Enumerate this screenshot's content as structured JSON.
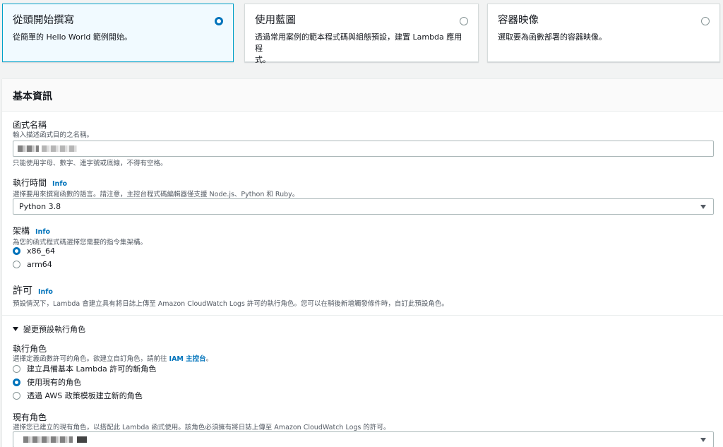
{
  "cards": [
    {
      "title": "從頭開始撰寫",
      "desc": "從簡單的 Hello World 範例開始。",
      "selected": true
    },
    {
      "title": "使用藍圖",
      "desc": "透過常用案例的範本程式碼與組態預設，建置 Lambda 應用程\n式。",
      "selected": false
    },
    {
      "title": "容器映像",
      "desc": "選取要為函數部署的容器映像。",
      "selected": false
    }
  ],
  "panel": {
    "title": "基本資訊"
  },
  "function_name": {
    "label": "函式名稱",
    "desc": "輸入描述函式目的之名稱。",
    "constraint": "只能使用字母、數字、連字號或底線，不得有空格。"
  },
  "runtime": {
    "label": "執行時間",
    "info": "Info",
    "desc": "選擇要用來撰寫函數的語言。請注意，主控台程式碼編輯器僅支援 Node.js、Python 和 Ruby。",
    "value": "Python 3.8"
  },
  "architecture": {
    "label": "架構",
    "info": "Info",
    "desc": "為您的函式程式碼選擇您需要的指令集架構。",
    "options": [
      {
        "label": "x86_64",
        "selected": true
      },
      {
        "label": "arm64",
        "selected": false
      }
    ]
  },
  "permissions": {
    "title": "許可",
    "info": "Info",
    "desc": "預設情況下，Lambda 會建立具有將日誌上傳至 Amazon CloudWatch Logs 許可的執行角色。您可以在稍後新增觸發條件時，自訂此預設角色。"
  },
  "change_role": {
    "label": "變更預設執行角色"
  },
  "execution_role": {
    "label": "執行角色",
    "desc_prefix": "選擇定義函數許可的角色。欲建立自訂角色，請前往 ",
    "desc_link": "IAM 主控台",
    "desc_suffix": "。",
    "options": [
      {
        "label": "建立具備基本 Lambda 許可的新角色",
        "selected": false
      },
      {
        "label": "使用現有的角色",
        "selected": true
      },
      {
        "label": "透過 AWS 政策模板建立新的角色",
        "selected": false
      }
    ]
  },
  "existing_role": {
    "label": "現有角色",
    "desc": "選擇您已建立的現有角色，以搭配此 Lambda 函式使用。該角色必須擁有將日誌上傳至 Amazon CloudWatch Logs 的許可。"
  }
}
